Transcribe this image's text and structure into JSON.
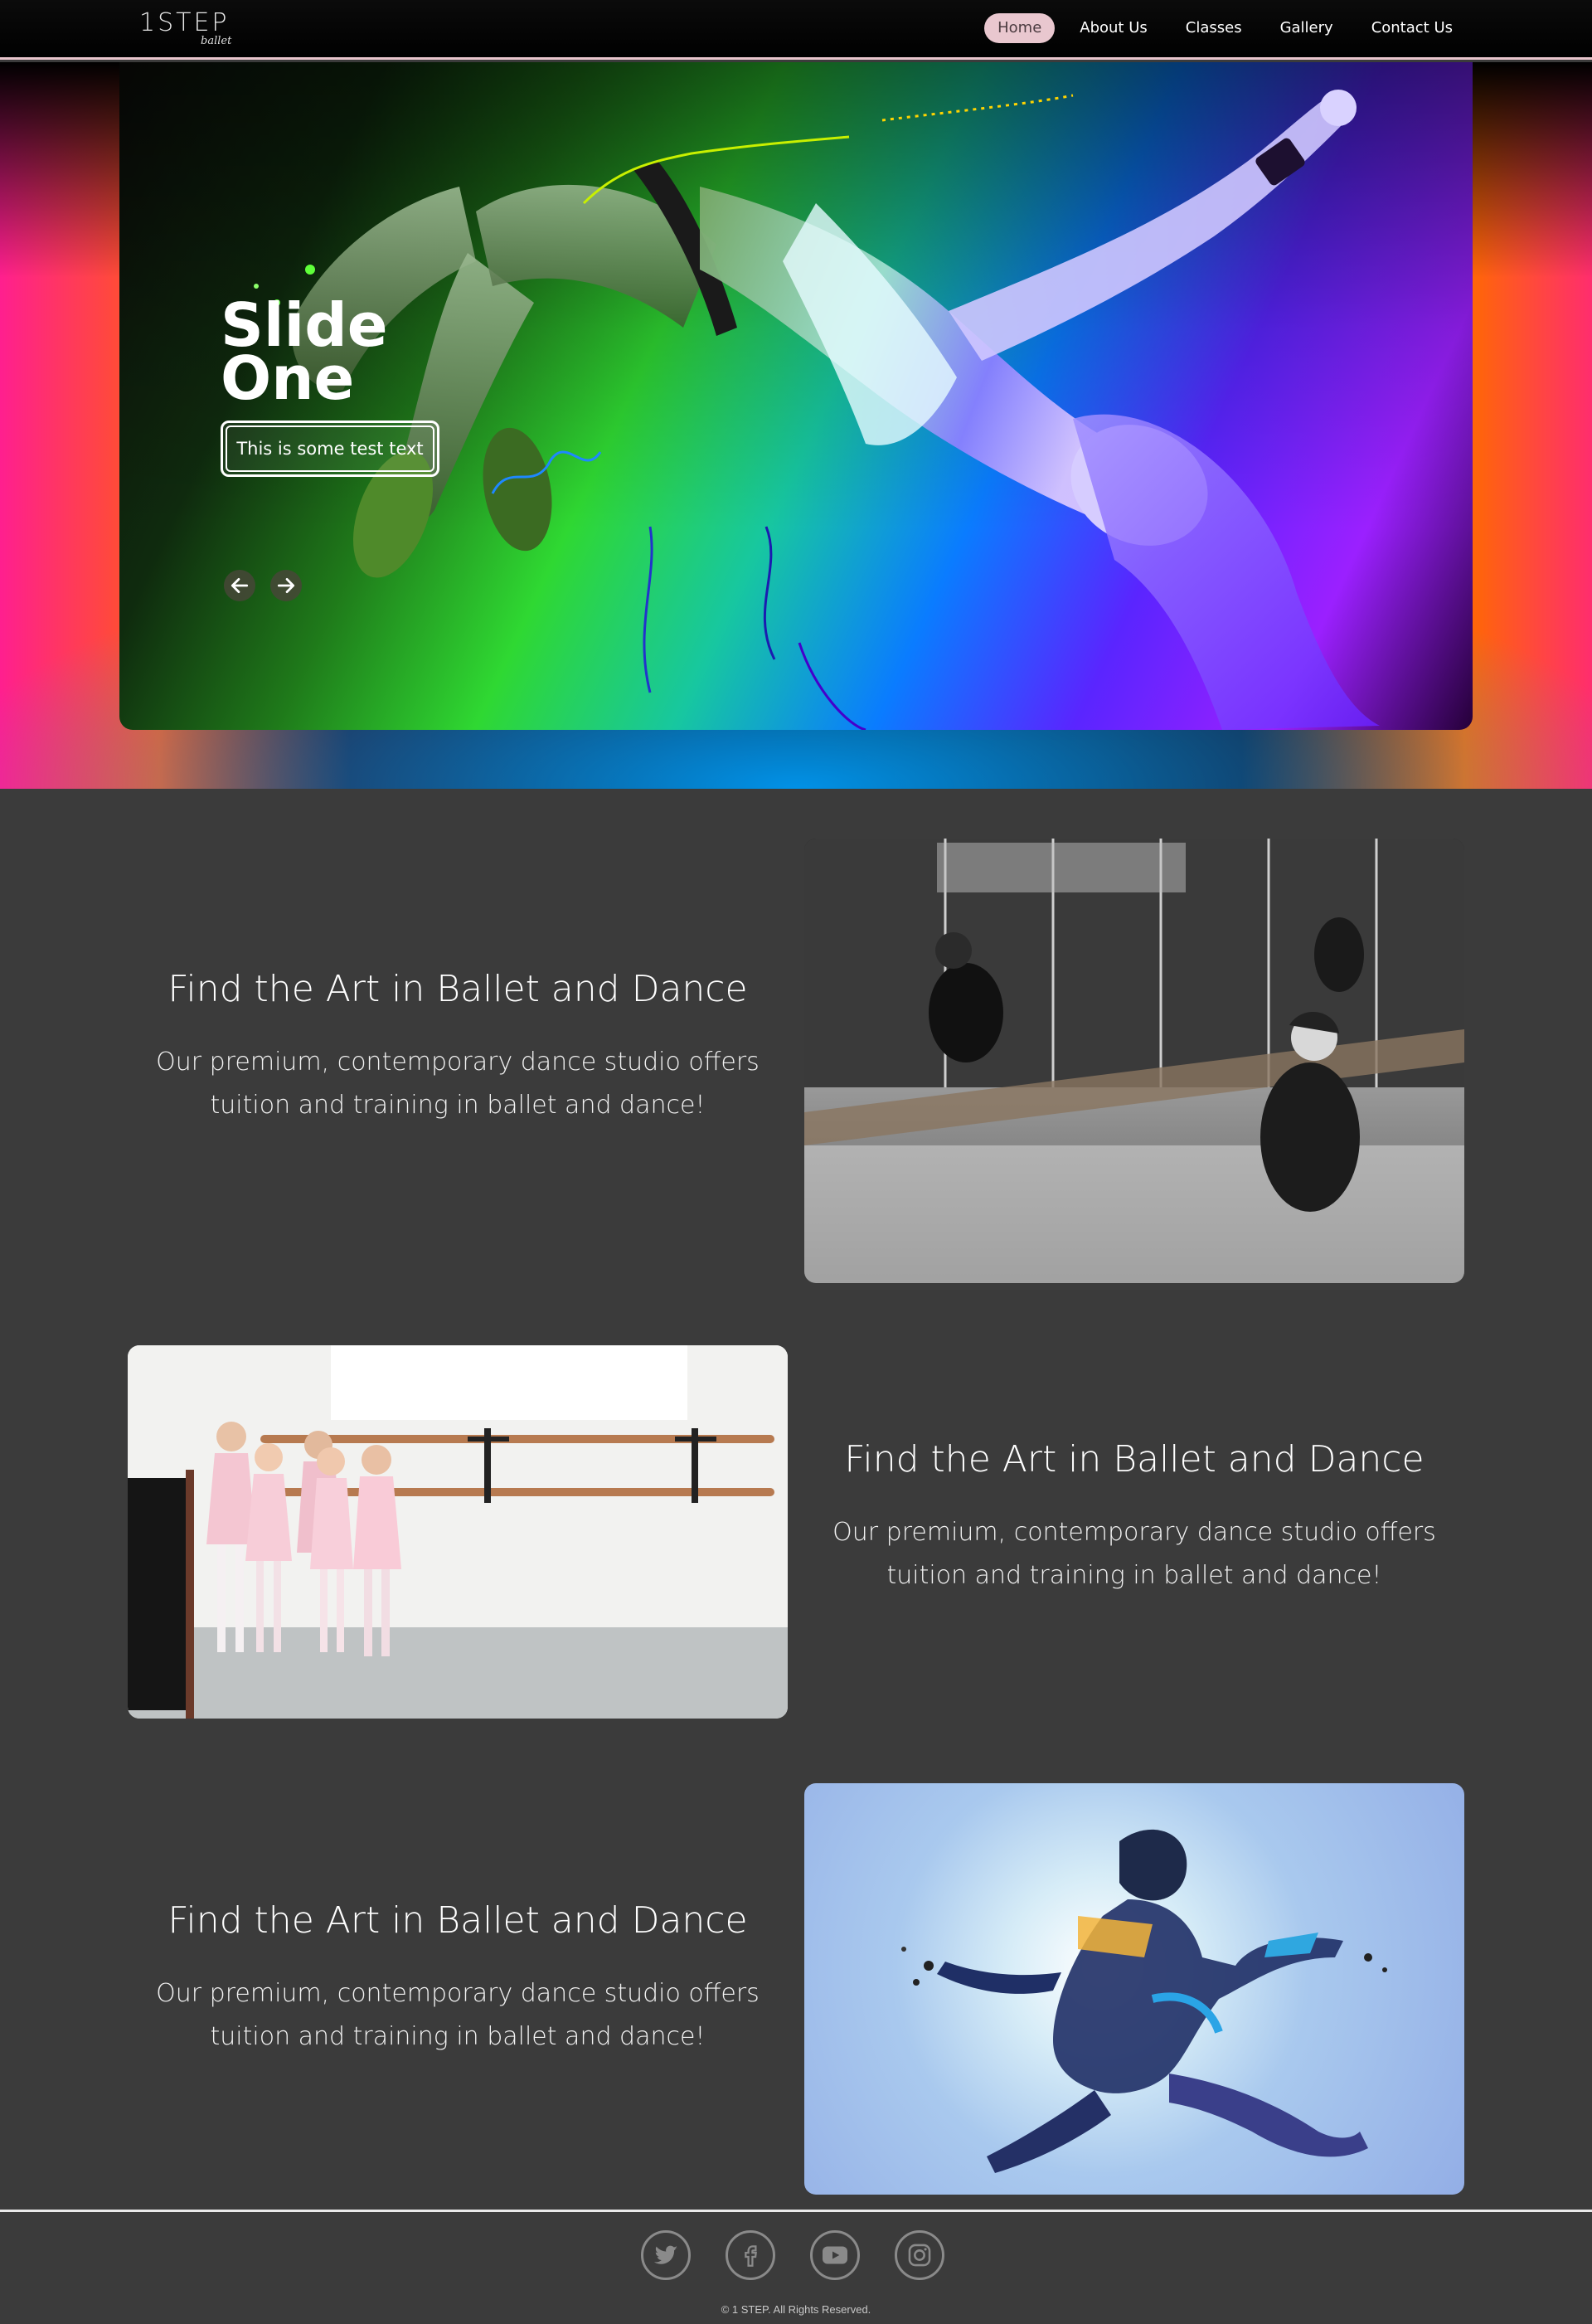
{
  "brand": {
    "name": "1STEP",
    "tagline": "ballet"
  },
  "nav": {
    "items": [
      {
        "label": "Home",
        "active": true
      },
      {
        "label": "About Us",
        "active": false
      },
      {
        "label": "Classes",
        "active": false
      },
      {
        "label": "Gallery",
        "active": false
      },
      {
        "label": "Contact Us",
        "active": false
      }
    ]
  },
  "hero": {
    "title": "Slide One",
    "button_label": "This is some test text",
    "prev_icon": "arrow-left-icon",
    "next_icon": "arrow-right-icon"
  },
  "features": [
    {
      "title": "Find the Art in Ballet and Dance",
      "description": "Our premium, contemporary dance studio offers tuition and training in ballet and dance!",
      "image": "dancers-sitting-by-mirror-photo"
    },
    {
      "title": "Find the Art in Ballet and Dance",
      "description": "Our premium, contemporary dance studio offers tuition and training in ballet and dance!",
      "image": "young-ballerinas-at-barre-photo"
    },
    {
      "title": "Find the Art in Ballet and Dance",
      "description": "Our premium, contemporary dance studio offers tuition and training in ballet and dance!",
      "image": "abstract-dancer-leap-artwork"
    }
  ],
  "footer": {
    "socials": [
      "twitter-icon",
      "facebook-icon",
      "youtube-icon",
      "instagram-icon"
    ],
    "copyright": "© 1 STEP. All Rights Reserved."
  },
  "colors": {
    "page_bg": "#3b3b3b",
    "nav_active_bg": "#e9c7cf",
    "nav_border": "#e6c4cb"
  }
}
